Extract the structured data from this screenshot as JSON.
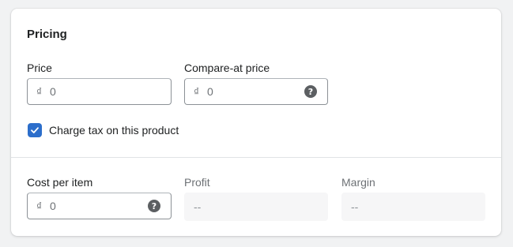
{
  "pricing": {
    "title": "Pricing",
    "price": {
      "label": "Price",
      "prefix": "₫",
      "value": "0"
    },
    "compare_at_price": {
      "label": "Compare-at price",
      "prefix": "₫",
      "value": "0",
      "help_icon": "question-circle-icon"
    },
    "charge_tax": {
      "label": "Charge tax on this product",
      "checked": true
    }
  },
  "cost": {
    "cost_per_item": {
      "label": "Cost per item",
      "prefix": "₫",
      "value": "0",
      "help_icon": "question-circle-icon"
    },
    "profit": {
      "label": "Profit",
      "value": "--"
    },
    "margin": {
      "label": "Margin",
      "value": "--"
    }
  },
  "colors": {
    "accent": "#2c6ecb",
    "icon": "#5c5f62",
    "readonly_bg": "#f6f6f7"
  }
}
